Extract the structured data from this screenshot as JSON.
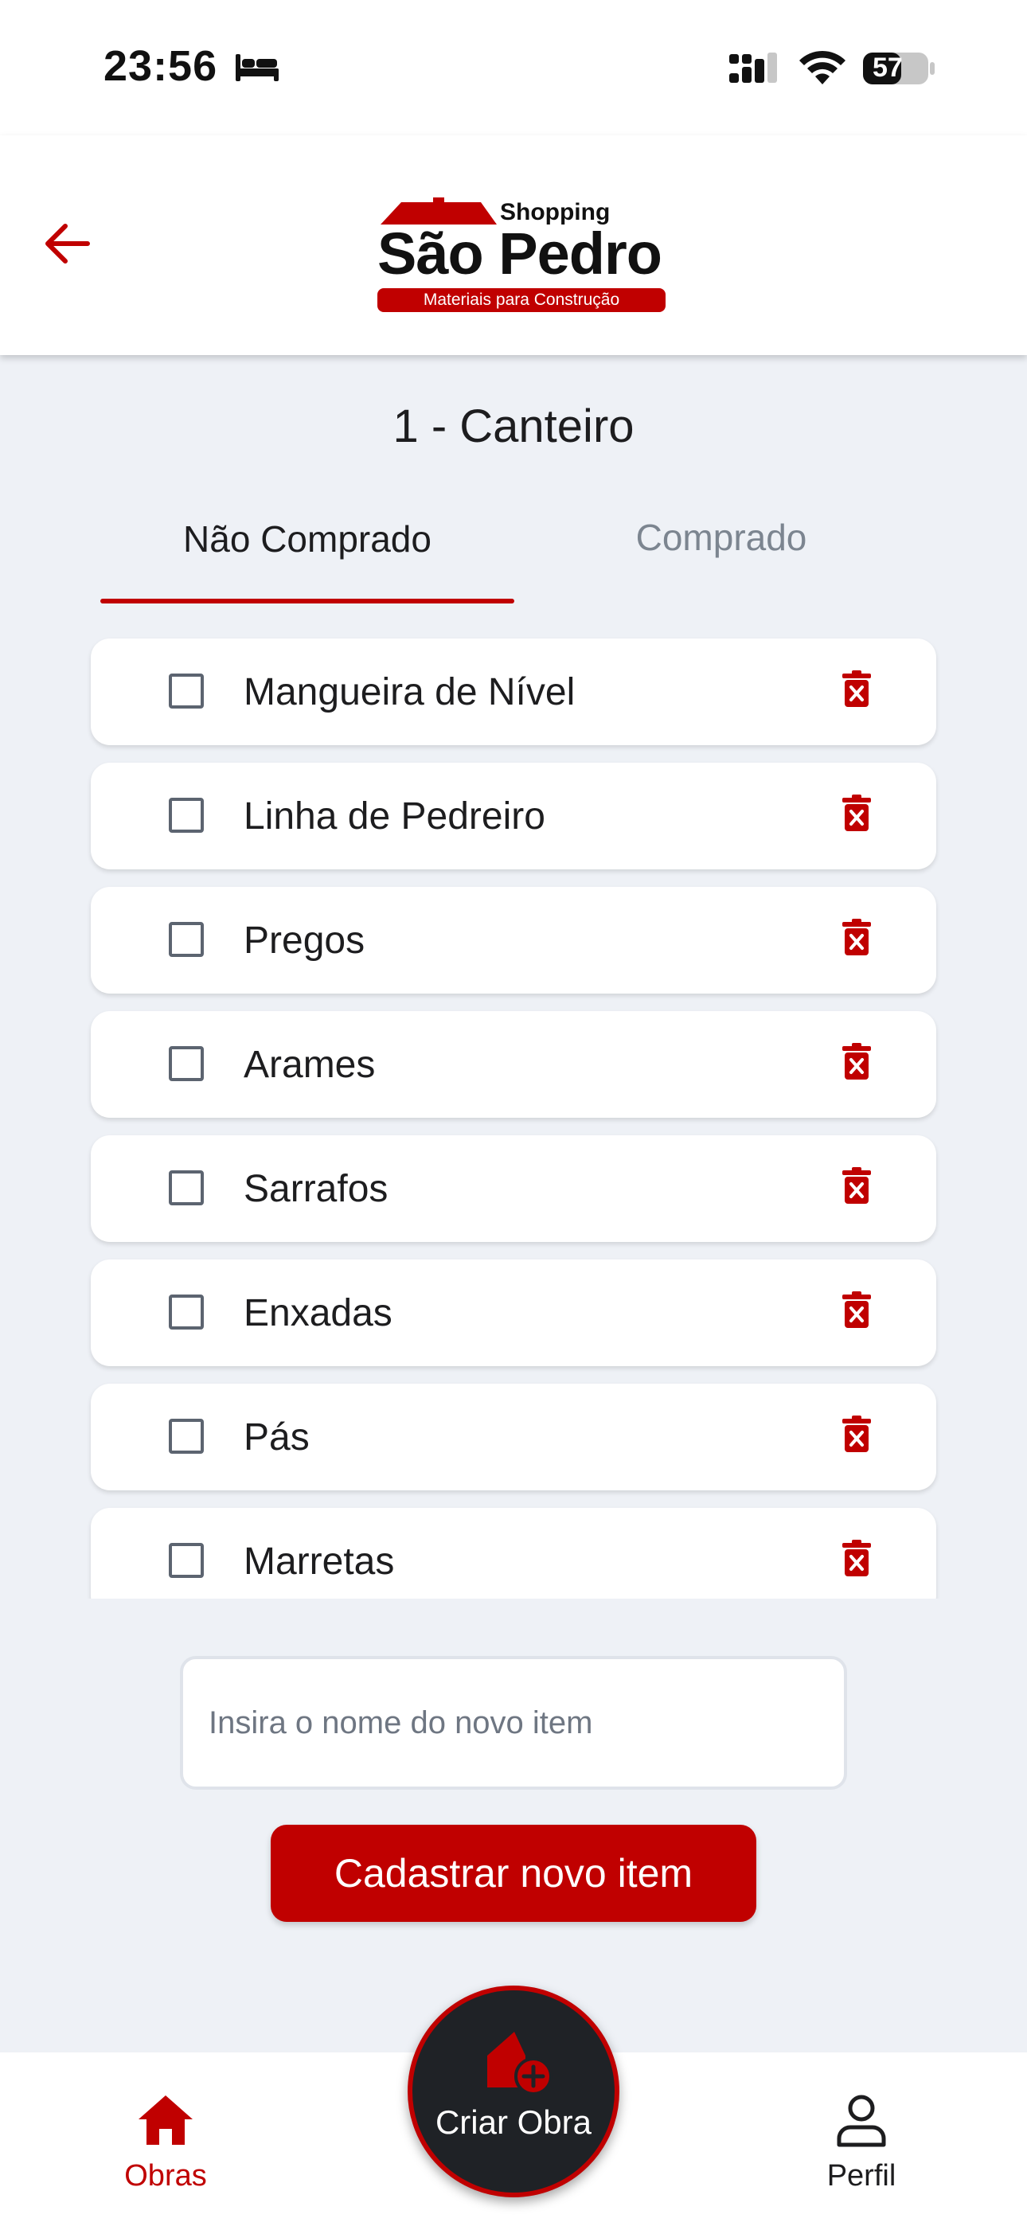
{
  "status_bar": {
    "time": "23:56",
    "battery": "57"
  },
  "header": {
    "logo": {
      "top_word": "Shopping",
      "main_word": "São Pedro",
      "tagline": "Materiais para Construção"
    }
  },
  "page": {
    "title": "1 - Canteiro"
  },
  "tabs": [
    {
      "label": "Não Comprado",
      "active": true
    },
    {
      "label": "Comprado",
      "active": false
    }
  ],
  "items": [
    {
      "label": "Mangueira de Nível",
      "checked": false
    },
    {
      "label": "Linha de Pedreiro",
      "checked": false
    },
    {
      "label": "Pregos",
      "checked": false
    },
    {
      "label": "Arames",
      "checked": false
    },
    {
      "label": "Sarrafos",
      "checked": false
    },
    {
      "label": "Enxadas",
      "checked": false
    },
    {
      "label": "Pás",
      "checked": false
    },
    {
      "label": "Marretas",
      "checked": false
    }
  ],
  "new_item": {
    "value": "",
    "placeholder": "Insira o nome do novo item"
  },
  "register_button": "Cadastrar novo item",
  "bottom_nav": {
    "obras": "Obras",
    "fab": "Criar Obra",
    "perfil": "Perfil"
  },
  "colors": {
    "brand_red": "#c00000",
    "background": "#eef1f6",
    "fab_dark": "#1f2226"
  }
}
